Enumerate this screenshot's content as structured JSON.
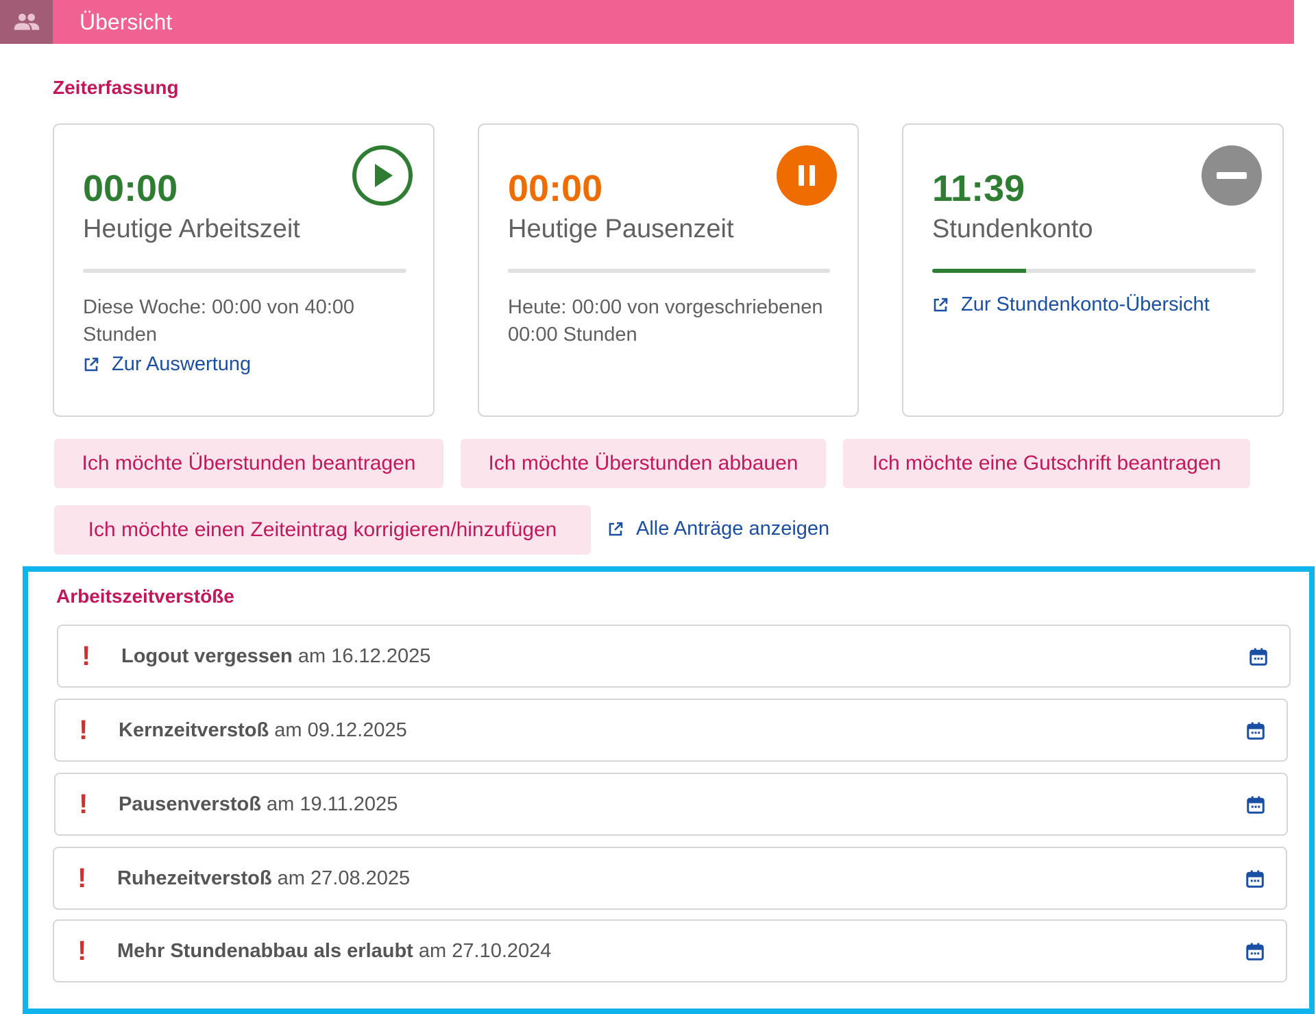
{
  "header": {
    "title": "Übersicht",
    "icon": "people-icon",
    "color": "#f06292"
  },
  "zeiterfassung": {
    "title": "Zeiterfassung",
    "cards": [
      {
        "value": "00:00",
        "label": "Heutige Arbeitszeit",
        "text": "Diese Woche: 00:00 von 40:00 Stunden",
        "link": "Zur Auswertung",
        "progress": 0,
        "icon": "play-icon",
        "value_color": "#2e7d32"
      },
      {
        "value": "00:00",
        "label": "Heutige Pausenzeit",
        "text": "Heute: 00:00 von vorgeschriebenen 00:00 Stunden",
        "progress": 0,
        "icon": "pause-icon",
        "value_color": "#ef6c00"
      },
      {
        "value": "11:39",
        "label": "Stundenkonto",
        "link": "Zur Stundenkonto-Übersicht",
        "progress": 0.29,
        "icon": "minus-icon",
        "value_color": "#2e7d32"
      }
    ]
  },
  "requests": {
    "buttons": [
      "Ich möchte Überstunden beantragen",
      "Ich möchte Überstunden abbauen",
      "Ich möchte eine Gutschrift beantragen",
      "Ich möchte einen Zeiteintrag korrigieren/hinzufügen"
    ],
    "all_link": "Alle Anträge anzeigen"
  },
  "violations": {
    "title": "Arbeitszeitverstöße",
    "items": [
      {
        "type": "Logout vergessen",
        "date": "am 16.12.2025"
      },
      {
        "type": "Kernzeitverstoß",
        "date": "am 09.12.2025"
      },
      {
        "type": "Pausenverstoß",
        "date": "am 19.11.2025"
      },
      {
        "type": "Ruhezeitverstoß",
        "date": "am 27.08.2025"
      },
      {
        "type": "Mehr Stundenabbau als erlaubt",
        "date": "am 27.10.2024"
      }
    ]
  },
  "colors": {
    "accent": "#c2185b",
    "link": "#1a4fa3",
    "highlight_frame": "#10b4ec",
    "violation_mark": "#d32f2f"
  }
}
